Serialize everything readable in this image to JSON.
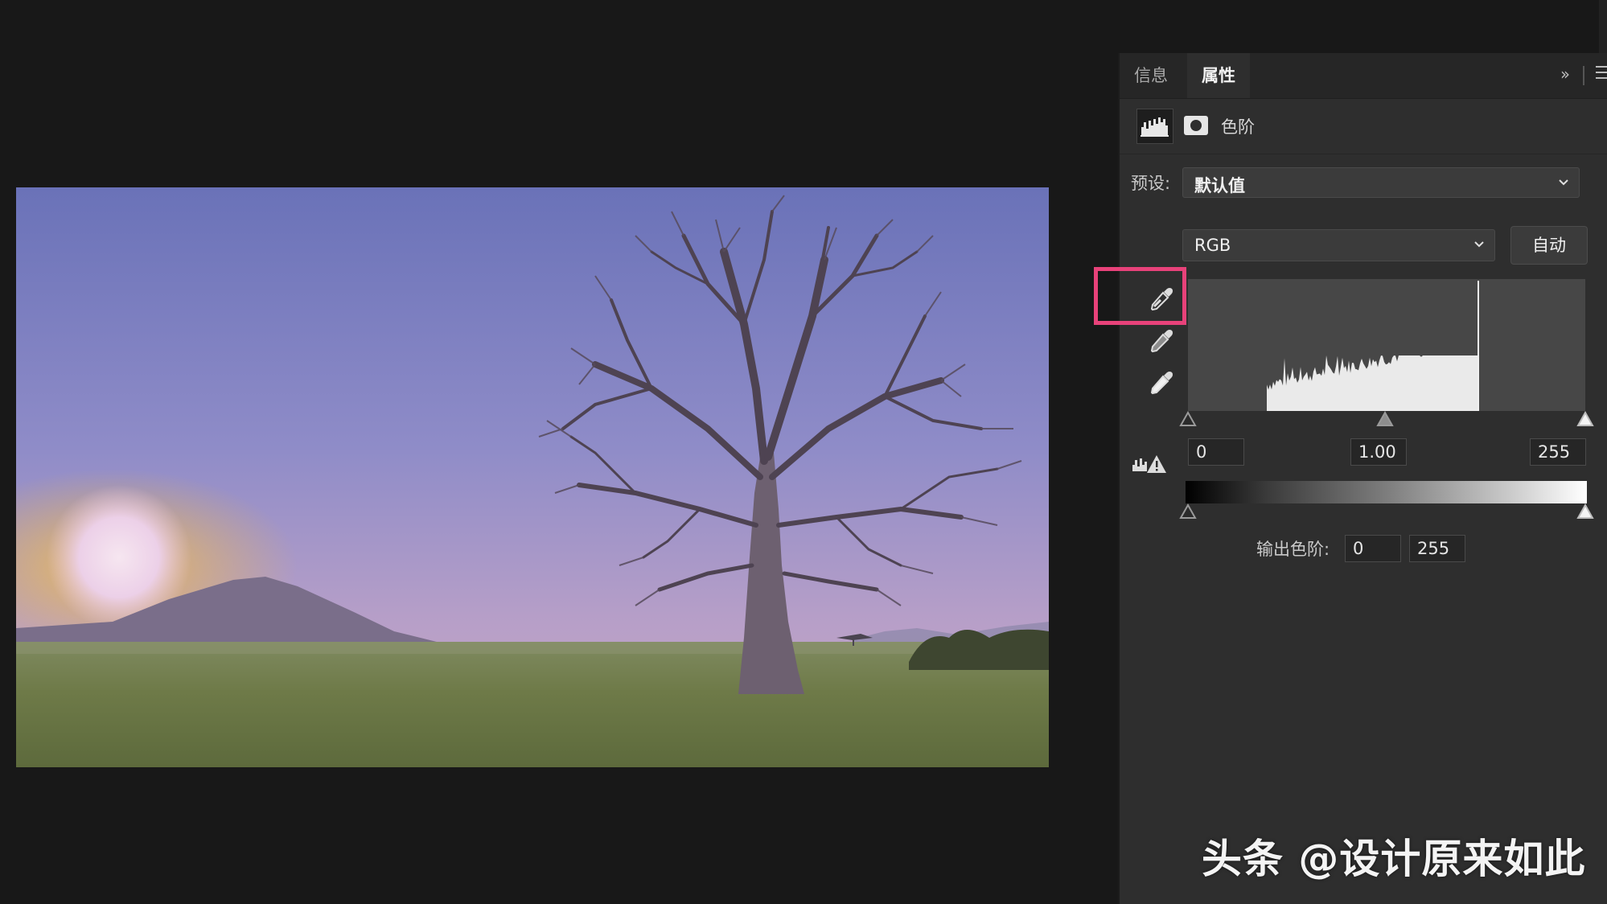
{
  "tabs": [
    {
      "label": "信息",
      "active": false
    },
    {
      "label": "属性",
      "active": true
    }
  ],
  "icons": {
    "collapse": "double-chevron-right-icon",
    "menu": "hamburger-menu-icon",
    "levels": "levels-histogram-icon",
    "mask": "mask-icon",
    "black_point": "eyedropper-icon",
    "gray_point": "eyedropper-icon",
    "white_point": "eyedropper-icon",
    "clipping": "clipping-warning-icon"
  },
  "adjustment": {
    "title": "色阶"
  },
  "preset": {
    "label": "预设:",
    "value": "默认值"
  },
  "channel": {
    "value": "RGB",
    "auto_label": "自动"
  },
  "input_levels": {
    "black": "0",
    "gamma": "1.00",
    "white": "255"
  },
  "output_levels": {
    "label": "输出色阶:",
    "black": "0",
    "white": "255"
  },
  "colors": {
    "highlight": "#e8427a",
    "panel_bg": "#2e2e2e",
    "canvas_bg": "#181818"
  },
  "watermark": "头条 @设计原来如此"
}
